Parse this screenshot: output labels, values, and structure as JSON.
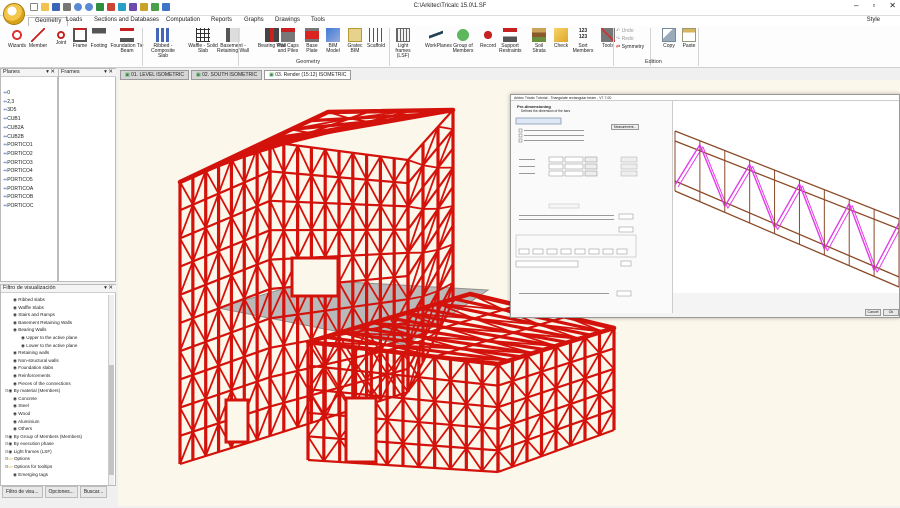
{
  "window": {
    "title": "C:\\Arkitec\\Tricalc 15.0\\1.SF",
    "style_label": "Style"
  },
  "menu": {
    "tabs": [
      "Geometry",
      "Loads",
      "Sections and Databases",
      "Computation",
      "Reports",
      "Graphs",
      "Drawings",
      "Tools"
    ]
  },
  "ribbon": {
    "buttons": [
      {
        "label": "Wizards",
        "icon": "wizard-icon"
      },
      {
        "label": "Member",
        "icon": "member-icon"
      },
      {
        "label": "Joint",
        "icon": "joint-icon"
      },
      {
        "label": "Frame",
        "icon": "frame-icon"
      },
      {
        "label": "Footing",
        "icon": "footing-icon"
      },
      {
        "label": "Foundation Tie Beam",
        "icon": "tie-beam-icon"
      },
      {
        "label": "Ribbed - Composite Slab",
        "icon": "ribbed-slab-icon"
      },
      {
        "label": "Waffle - Solid Slab",
        "icon": "waffle-slab-icon"
      },
      {
        "label": "Basement - Retaining Wall",
        "icon": "retaining-wall-icon"
      },
      {
        "label": "Bearing Wall",
        "icon": "bearing-wall-icon"
      },
      {
        "label": "Pile Caps and Piles",
        "icon": "pile-cap-icon"
      },
      {
        "label": "Base Plate",
        "icon": "base-plate-icon"
      },
      {
        "label": "BIM Model",
        "icon": "bim-model-icon"
      },
      {
        "label": "Gratec BIM",
        "icon": "gratec-icon"
      },
      {
        "label": "Scaffold",
        "icon": "scaffold-icon"
      },
      {
        "label": "Light frames (LSF)",
        "icon": "light-frame-icon"
      },
      {
        "label": "WorkPlanes",
        "icon": "workplane-icon"
      },
      {
        "label": "Group of Members",
        "icon": "group-members-icon"
      },
      {
        "label": "Record",
        "icon": "record-icon"
      },
      {
        "label": "Support Restraints",
        "icon": "support-icon"
      },
      {
        "label": "Soil Strata",
        "icon": "soil-icon"
      },
      {
        "label": "Check",
        "icon": "check-icon"
      },
      {
        "label": "Sort Members",
        "icon": "sort-icon"
      },
      {
        "label": "Tools",
        "icon": "tools-icon"
      },
      {
        "label": "Copy",
        "icon": "copy-icon"
      },
      {
        "label": "Paste",
        "icon": "paste-icon"
      }
    ],
    "sort_digits": "123 123",
    "undo_label": "Undo",
    "redo_label": "Redo",
    "symmetry_label": "Symmetry",
    "geometry_group": "Geometry",
    "edition_group": "Edition"
  },
  "planes": {
    "header": "Planes",
    "items": [
      "0",
      "2,3",
      "3D5",
      "CUB1",
      "CUB2A",
      "CUB2B",
      "PORTICO1",
      "PORTICO2",
      "PORTICO3",
      "PORTICO4",
      "PORTICO5",
      "PORTICOA",
      "PORTICOB",
      "PORTICOC"
    ]
  },
  "frames": {
    "header": "Frames"
  },
  "filter": {
    "header": "Filtro de visualización",
    "items": [
      {
        "label": "Ribbed slabs",
        "level": 2
      },
      {
        "label": "Waffle Slabs",
        "level": 2
      },
      {
        "label": "Stairs and Ramps",
        "level": 2
      },
      {
        "label": "Basement Retaining Walls",
        "level": 2
      },
      {
        "label": "Bearing Walls",
        "level": 2
      },
      {
        "label": "Upper to the active plane",
        "level": 3
      },
      {
        "label": "Lower to the active plane",
        "level": 3
      },
      {
        "label": "Retaining walls",
        "level": 2
      },
      {
        "label": "Non-structural walls",
        "level": 2
      },
      {
        "label": "Foundation slabs",
        "level": 2
      },
      {
        "label": "Reinforcements",
        "level": 2
      },
      {
        "label": "Pieces of the connections",
        "level": 2
      },
      {
        "label": "By material (Members)",
        "level": 1
      },
      {
        "label": "Concrete",
        "level": 2
      },
      {
        "label": "Steel",
        "level": 2
      },
      {
        "label": "Wood",
        "level": 2
      },
      {
        "label": "Aluminium",
        "level": 2
      },
      {
        "label": "Others",
        "level": 2
      },
      {
        "label": "By Group of Members (Members)",
        "level": 1
      },
      {
        "label": "By execution phase",
        "level": 1
      },
      {
        "label": "Light frames (LSF)",
        "level": 1
      },
      {
        "label": "Options",
        "level": 1
      },
      {
        "label": "Options for tooltips",
        "level": 1
      },
      {
        "label": "Emerging tags",
        "level": 2
      }
    ],
    "tabs": [
      "Filtro de visu...",
      "Opciones...",
      "Buscar..."
    ]
  },
  "views": {
    "tabs": [
      "01. LEVEL  ISOMETRIC",
      "02. SOUTH  ISOMETRIC",
      "03. Render  (15:12)  ISOMETRIC"
    ],
    "active": 2
  },
  "dialog": {
    "title": "Arktec Tricalc Tutorial - Triangulate rectangular beam - V7.7.00",
    "heading": "Pre-dimensioning",
    "subheading": "Defines the dimension of the bars",
    "measurement_btn": "Measurement...",
    "ok_btn": "Ok",
    "cancel_btn": "Cancel"
  },
  "colors": {
    "structure": "#d4120c",
    "slab": "#b9b9b9",
    "viewport_bg": "#fbf7ea",
    "truss_pink": "#e23ce8",
    "truss_brown": "#8a4a28"
  }
}
